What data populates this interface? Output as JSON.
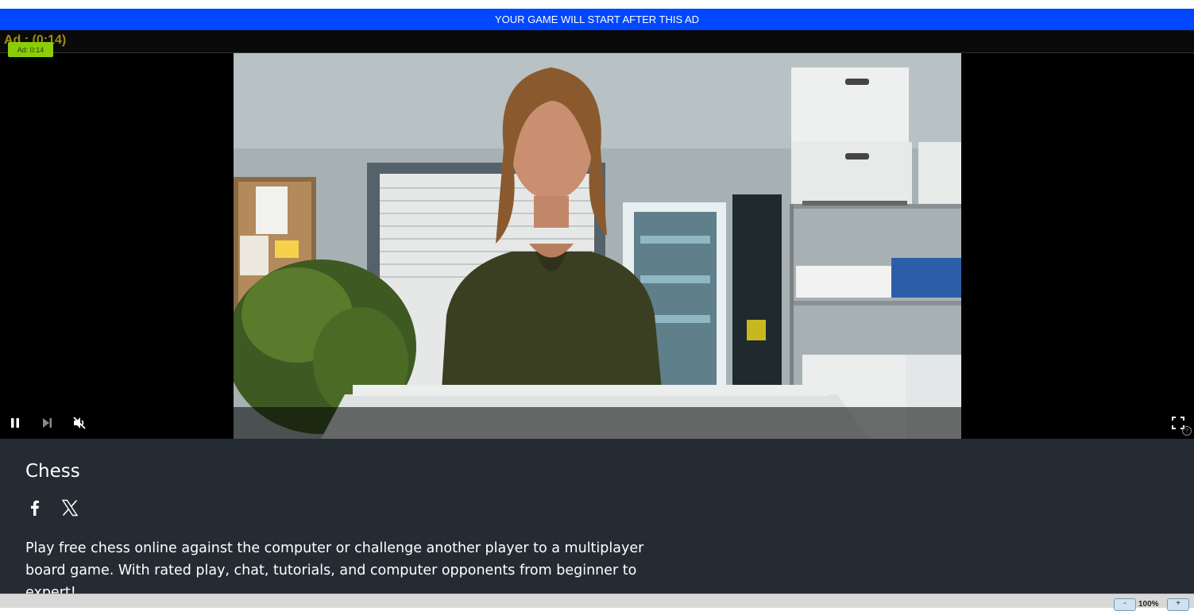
{
  "ad_banner": {
    "text": "YOUR GAME WILL START AFTER THIS AD"
  },
  "player": {
    "ad_timer_text": "Ad : (0:14)",
    "ad_badge": "Ad: 0:14",
    "controls": {
      "pause_icon": "pause-icon",
      "skip_icon": "skip-next-icon",
      "mute_icon": "muted-speaker-icon",
      "fullscreen_icon": "fullscreen-icon",
      "help_glyph": "?"
    },
    "colors": {
      "ad_badge": "#8acd08",
      "banner": "#0047ff"
    }
  },
  "game": {
    "title": "Chess",
    "social": [
      {
        "name": "facebook",
        "icon": "facebook-icon"
      },
      {
        "name": "x",
        "icon": "x-twitter-icon"
      }
    ],
    "description": "Play free chess online against the computer or challenge another player to a multiplayer board game. With rated play, chat, tutorials, and computer opponents from beginner to expert!"
  },
  "zoom": {
    "minus": "-",
    "level": "100%",
    "plus": "+"
  }
}
